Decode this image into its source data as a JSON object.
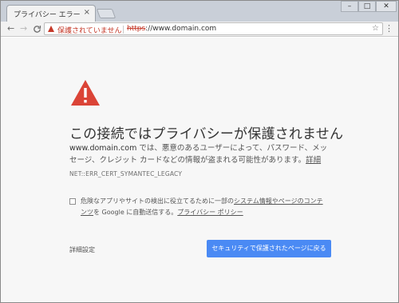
{
  "tab": {
    "title": "プライバシー エラー",
    "close": "×"
  },
  "window_controls": {
    "minimize": "–",
    "maximize": "□",
    "close": "✕"
  },
  "toolbar": {
    "back": "←",
    "forward": "→",
    "reload": "C",
    "security_label": "保護されていません",
    "url_scheme": "https",
    "url_rest": "://www.domain.com",
    "star": "☆",
    "menu": "⋮"
  },
  "error_page": {
    "headline": "この接続ではプライバシーが保護されません",
    "domain": "www.domain.com",
    "message_rest": " では、悪意のあるユーザーによって、パスワード、メッセージ、クレジット カードなどの情報が盗まれる可能性があります。",
    "details_link": "詳細",
    "error_code": "NET::ERR_CERT_SYMANTEC_LEGACY",
    "checkbox_prefix": "危険なアプリやサイトの検出に役立てるために一部の",
    "checkbox_link1": "システム情報やページのコンテンツ",
    "checkbox_mid": "を Google に自動送信する。",
    "checkbox_link2": "プライバシー ポリシー",
    "advanced_label": "詳細設定",
    "back_to_safety_label": "セキュリティで保護されたページに戻る"
  },
  "icons": {
    "page_warning": "warning-triangle-icon",
    "toolbar_warning": "warning-triangle-icon",
    "star": "star-icon",
    "menu": "menu-icon"
  },
  "colors": {
    "warning_red": "#db4437",
    "insecure_red": "#c53929",
    "primary_button": "#4a8af4",
    "page_background": "#f7f7f7"
  }
}
